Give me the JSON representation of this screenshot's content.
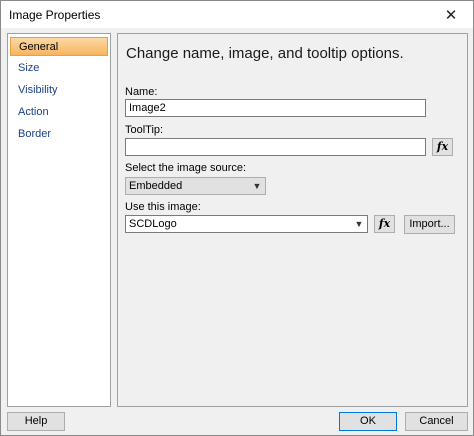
{
  "window": {
    "title": "Image Properties",
    "close_glyph": "✕"
  },
  "sidebar": {
    "items": [
      {
        "label": "General",
        "active": true
      },
      {
        "label": "Size"
      },
      {
        "label": "Visibility"
      },
      {
        "label": "Action"
      },
      {
        "label": "Border"
      }
    ]
  },
  "general": {
    "heading": "Change name, image, and tooltip options.",
    "name_label": "Name:",
    "name_value": "Image2",
    "tooltip_label": "ToolTip:",
    "tooltip_value": "",
    "source_label": "Select the image source:",
    "source_value": "Embedded",
    "image_label": "Use this image:",
    "image_value": "SCDLogo",
    "fx_label": "fx",
    "import_label": "Import..."
  },
  "footer": {
    "help_label": "Help",
    "ok_label": "OK",
    "cancel_label": "Cancel"
  },
  "colors": {
    "active_item": "#f7b45e",
    "link_text": "#1a3f8a",
    "default_button_border": "#0078d7"
  }
}
